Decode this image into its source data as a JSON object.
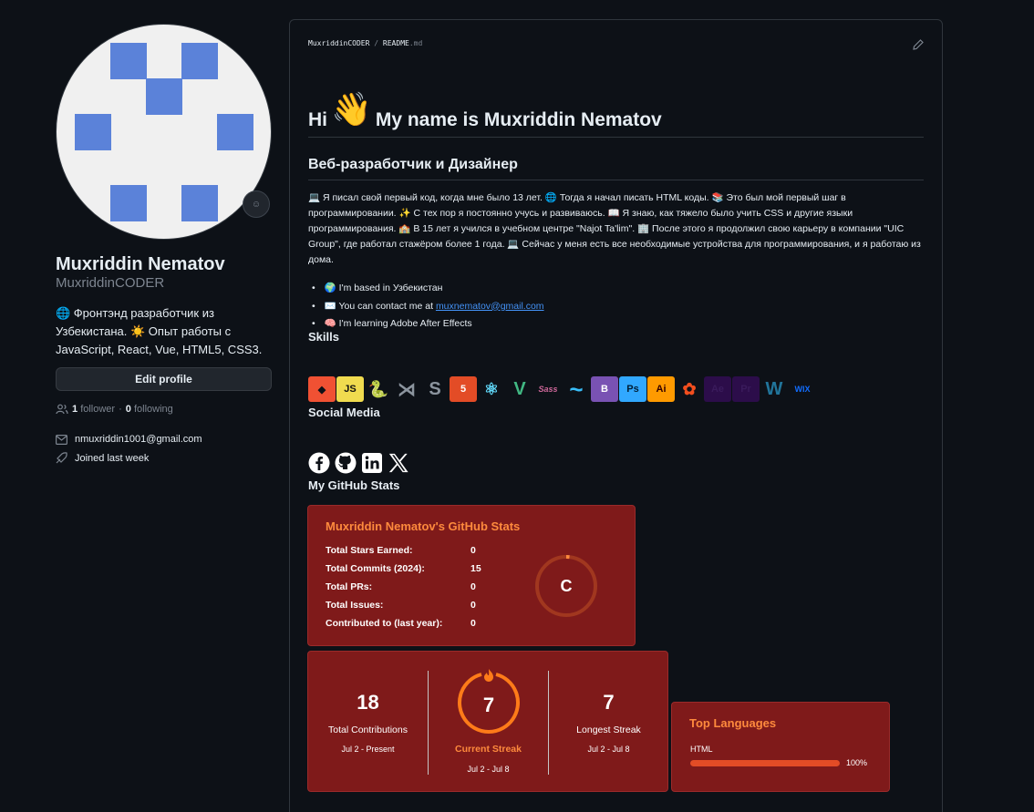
{
  "profile": {
    "name": "Muxriddin Nematov",
    "login": "MuxriddinCODER",
    "bio": "🌐 Фронтэнд разработчик из Узбекистана. ☀️ Опыт работы с JavaScript, React, Vue, HTML5, CSS3.",
    "edit_label": "Edit profile",
    "followers_count": "1",
    "followers_label": "follower",
    "dot": "·",
    "following_count": "0",
    "following_label": "following",
    "email": "nmuxriddin1001@gmail.com",
    "joined": "Joined last week",
    "avatar_color": "#5b82d9"
  },
  "readme": {
    "crumb_user": "MuxriddinCODER",
    "crumb_sep": "/",
    "crumb_file": "README",
    "crumb_ext": ".md",
    "h1_pre": "Hi",
    "h1_wave": "👋",
    "h1_post": "My name is Muxriddin Nematov",
    "h2": "Веб-разработчик и Дизайнер",
    "paragraph": "💻 Я писал свой первый код, когда мне было 13 лет. 🌐 Тогда я начал писать HTML коды. 📚 Это был мой первый шаг в программировании. ✨ С тех пор я постоянно учусь и развиваюсь. 📖 Я знаю, как тяжело было учить CSS и другие языки программирования. 🏫 В 15 лет я учился в учебном центре \"Najot Ta'lim\". 🏢 После этого я продолжил свою карьеру в компании \"UIC Group\", где работал стажёром более 1 года. 💻 Сейчас у меня есть все необходимые устройства для программирования, и я работаю из дома.",
    "bullet1": "🌍 I'm based in Узбекистан",
    "bullet2_pre": "✉️ You can contact me at",
    "bullet2_link": "muxnematov@gmail.com",
    "bullet3": "🧠 I'm learning Adobe After Effects",
    "skills_title": "Skills",
    "social_title": "Social Media",
    "stats_title": "My GitHub Stats"
  },
  "skills": [
    {
      "name": "git",
      "text": "◆",
      "bg": "#f05133",
      "fg": "#0d1117"
    },
    {
      "name": "javascript",
      "text": "JS",
      "bg": "#f0db4f",
      "fg": "#111111"
    },
    {
      "name": "python",
      "text": "🐍",
      "bg": "transparent",
      "fg": "#3776ab"
    },
    {
      "name": "vscode",
      "text": "⋊",
      "bg": "transparent",
      "fg": "#8b949e"
    },
    {
      "name": "stylus",
      "text": "S",
      "bg": "transparent",
      "fg": "#8b949e"
    },
    {
      "name": "html5",
      "text": "5",
      "bg": "#e34c26",
      "fg": "#ffffff"
    },
    {
      "name": "react",
      "text": "⚛",
      "bg": "transparent",
      "fg": "#61dafb"
    },
    {
      "name": "vue",
      "text": "V",
      "bg": "transparent",
      "fg": "#41b883"
    },
    {
      "name": "sass",
      "text": "Sass",
      "bg": "transparent",
      "fg": "#cd6799"
    },
    {
      "name": "tailwind",
      "text": "~",
      "bg": "transparent",
      "fg": "#38bdf8"
    },
    {
      "name": "bootstrap",
      "text": "B",
      "bg": "#7952b3",
      "fg": "#ffffff"
    },
    {
      "name": "photoshop",
      "text": "Ps",
      "bg": "#31a8ff",
      "fg": "#001e36"
    },
    {
      "name": "illustrator",
      "text": "Ai",
      "bg": "#ff9a00",
      "fg": "#330000"
    },
    {
      "name": "figma",
      "text": "✿",
      "bg": "transparent",
      "fg": "#f24e1e"
    },
    {
      "name": "after-effects",
      "text": "Ae",
      "bg": "#2c0d4a",
      "fg": "#3a1b5c"
    },
    {
      "name": "premiere",
      "text": "Pr",
      "bg": "#2c0d4a",
      "fg": "#3a1b5c"
    },
    {
      "name": "wordpress",
      "text": "W",
      "bg": "transparent",
      "fg": "#21759b"
    },
    {
      "name": "wix",
      "text": "WIX",
      "bg": "transparent",
      "fg": "#116dff"
    }
  ],
  "stats": {
    "title": "Muxriddin Nematov's GitHub Stats",
    "rows": [
      {
        "label": "Total Stars Earned:",
        "value": "0"
      },
      {
        "label": "Total Commits (2024):",
        "value": "15"
      },
      {
        "label": "Total PRs:",
        "value": "0"
      },
      {
        "label": "Total Issues:",
        "value": "0"
      },
      {
        "label": "Contributed to (last year):",
        "value": "0"
      }
    ],
    "rank": "C",
    "accent": "#fe8a3d",
    "card_bg": "#7f1a1a"
  },
  "streak": {
    "total_num": "18",
    "total_label": "Total Contributions",
    "total_dates": "Jul 2 - Present",
    "current_num": "7",
    "current_label": "Current Streak",
    "current_dates": "Jul 2 - Jul 8",
    "longest_num": "7",
    "longest_label": "Longest Streak",
    "longest_dates": "Jul 2 - Jul 8"
  },
  "languages": {
    "title": "Top Languages",
    "name": "HTML",
    "percent_label": "100%",
    "percent": 100,
    "bar_color": "#e34c26"
  }
}
